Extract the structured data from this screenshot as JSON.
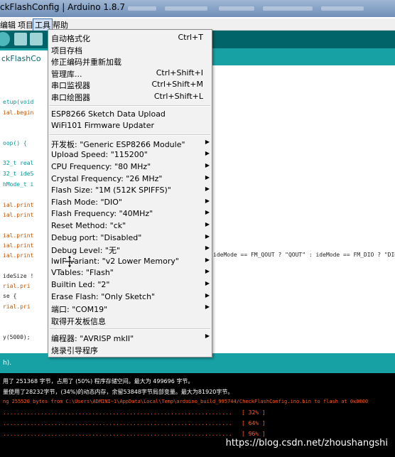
{
  "window": {
    "title": "ckFlashConfig | Arduino 1.8.7"
  },
  "menubar": {
    "items": [
      "编辑",
      "项目",
      "工具",
      "帮助"
    ]
  },
  "editor": {
    "tab_label": "ckFlashCo",
    "lines": [
      {
        "text": "etup(void",
        "color": "teal"
      },
      {
        "text": "ial.begin",
        "color": "orange"
      },
      {
        "text": "oop() {",
        "color": "teal"
      },
      {
        "text": "32_t real",
        "color": "teal"
      },
      {
        "text": "32_t ideS",
        "color": "teal"
      },
      {
        "text": "hMode_t i",
        "color": "teal"
      },
      {
        "text": "ial.print",
        "color": "orange"
      },
      {
        "text": "ial.print",
        "color": "orange"
      },
      {
        "text": "ial.print",
        "color": "orange"
      },
      {
        "text": "ial.print",
        "color": "orange"
      },
      {
        "text": "ial.print",
        "color": "orange"
      },
      {
        "text": "ideSize !",
        "color": "dark"
      },
      {
        "text": "rial.pri",
        "color": "orange"
      },
      {
        "text": "se {",
        "color": "dark"
      },
      {
        "text": "rial.pri",
        "color": "orange"
      },
      {
        "text": "y(5000);",
        "color": "dark"
      }
    ],
    "long_line": "ideMode == FM_QOUT ? \"QOUT\" : ideMode == FM_DIO ? \"DIO\""
  },
  "status": {
    "text": "h)."
  },
  "console": {
    "lines": [
      "用了 251368 字节，占用了 (50%) 程序存储空间。最大为 499696 字节。",
      "量使用了28232字节，(34%)的动态内存，余留53848字节局部变量。最大为81920字节。",
      "ng 255520 bytes from C:\\Users\\ADMINI~1\\AppData\\Local\\Temp\\arduino_build_995744/CheckFlashConfig.ino.bin to flash at 0x0000",
      "[ 32% ]",
      "[ 64% ]",
      "[ 96% ]"
    ],
    "watermark": "https://blog.csdn.net/zhoushangshi"
  },
  "tools_menu": {
    "groups": [
      [
        {
          "label": "自动格式化",
          "shortcut": "Ctrl+T"
        },
        {
          "label": "项目存档",
          "shortcut": ""
        },
        {
          "label": "修正编码并重新加载",
          "shortcut": ""
        },
        {
          "label": "管理库...",
          "shortcut": "Ctrl+Shift+I"
        },
        {
          "label": "串口监视器",
          "shortcut": "Ctrl+Shift+M"
        },
        {
          "label": "串口绘图器",
          "shortcut": "Ctrl+Shift+L"
        }
      ],
      [
        {
          "label": "ESP8266 Sketch Data Upload",
          "shortcut": ""
        },
        {
          "label": "WiFi101 Firmware Updater",
          "shortcut": ""
        }
      ],
      [
        {
          "label": "开发板: \"Generic ESP8266 Module\"",
          "submenu": true
        },
        {
          "label": "Upload Speed: \"115200\"",
          "submenu": true
        },
        {
          "label": "CPU Frequency: \"80 MHz\"",
          "submenu": true
        },
        {
          "label": "Crystal Frequency: \"26 MHz\"",
          "submenu": true
        },
        {
          "label": "Flash Size: \"1M (512K SPIFFS)\"",
          "submenu": true
        },
        {
          "label": "Flash Mode: \"DIO\"",
          "submenu": true
        },
        {
          "label": "Flash Frequency: \"40MHz\"",
          "submenu": true
        },
        {
          "label": "Reset Method: \"ck\"",
          "submenu": true
        },
        {
          "label": "Debug port: \"Disabled\"",
          "submenu": true
        },
        {
          "label": "Debug Level: \"无\"",
          "submenu": true
        },
        {
          "label": "lwIP Variant: \"v2 Lower Memory\"",
          "submenu": true
        },
        {
          "label": "VTables: \"Flash\"",
          "submenu": true
        },
        {
          "label": "Builtin Led: \"2\"",
          "submenu": true
        },
        {
          "label": "Erase Flash: \"Only Sketch\"",
          "submenu": true
        },
        {
          "label": "端口: \"COM19\"",
          "submenu": true
        },
        {
          "label": "取得开发板信息",
          "submenu": false
        }
      ],
      [
        {
          "label": "编程器: \"AVRISP mkII\"",
          "submenu": true
        },
        {
          "label": "烧录引导程序",
          "submenu": false
        }
      ]
    ]
  },
  "colors": {
    "teal_dark": "#006468",
    "teal": "#17a1a5",
    "console_red": "#ff5a1f"
  },
  "icons": {
    "submenu_arrow": "triangle-right-icon"
  }
}
